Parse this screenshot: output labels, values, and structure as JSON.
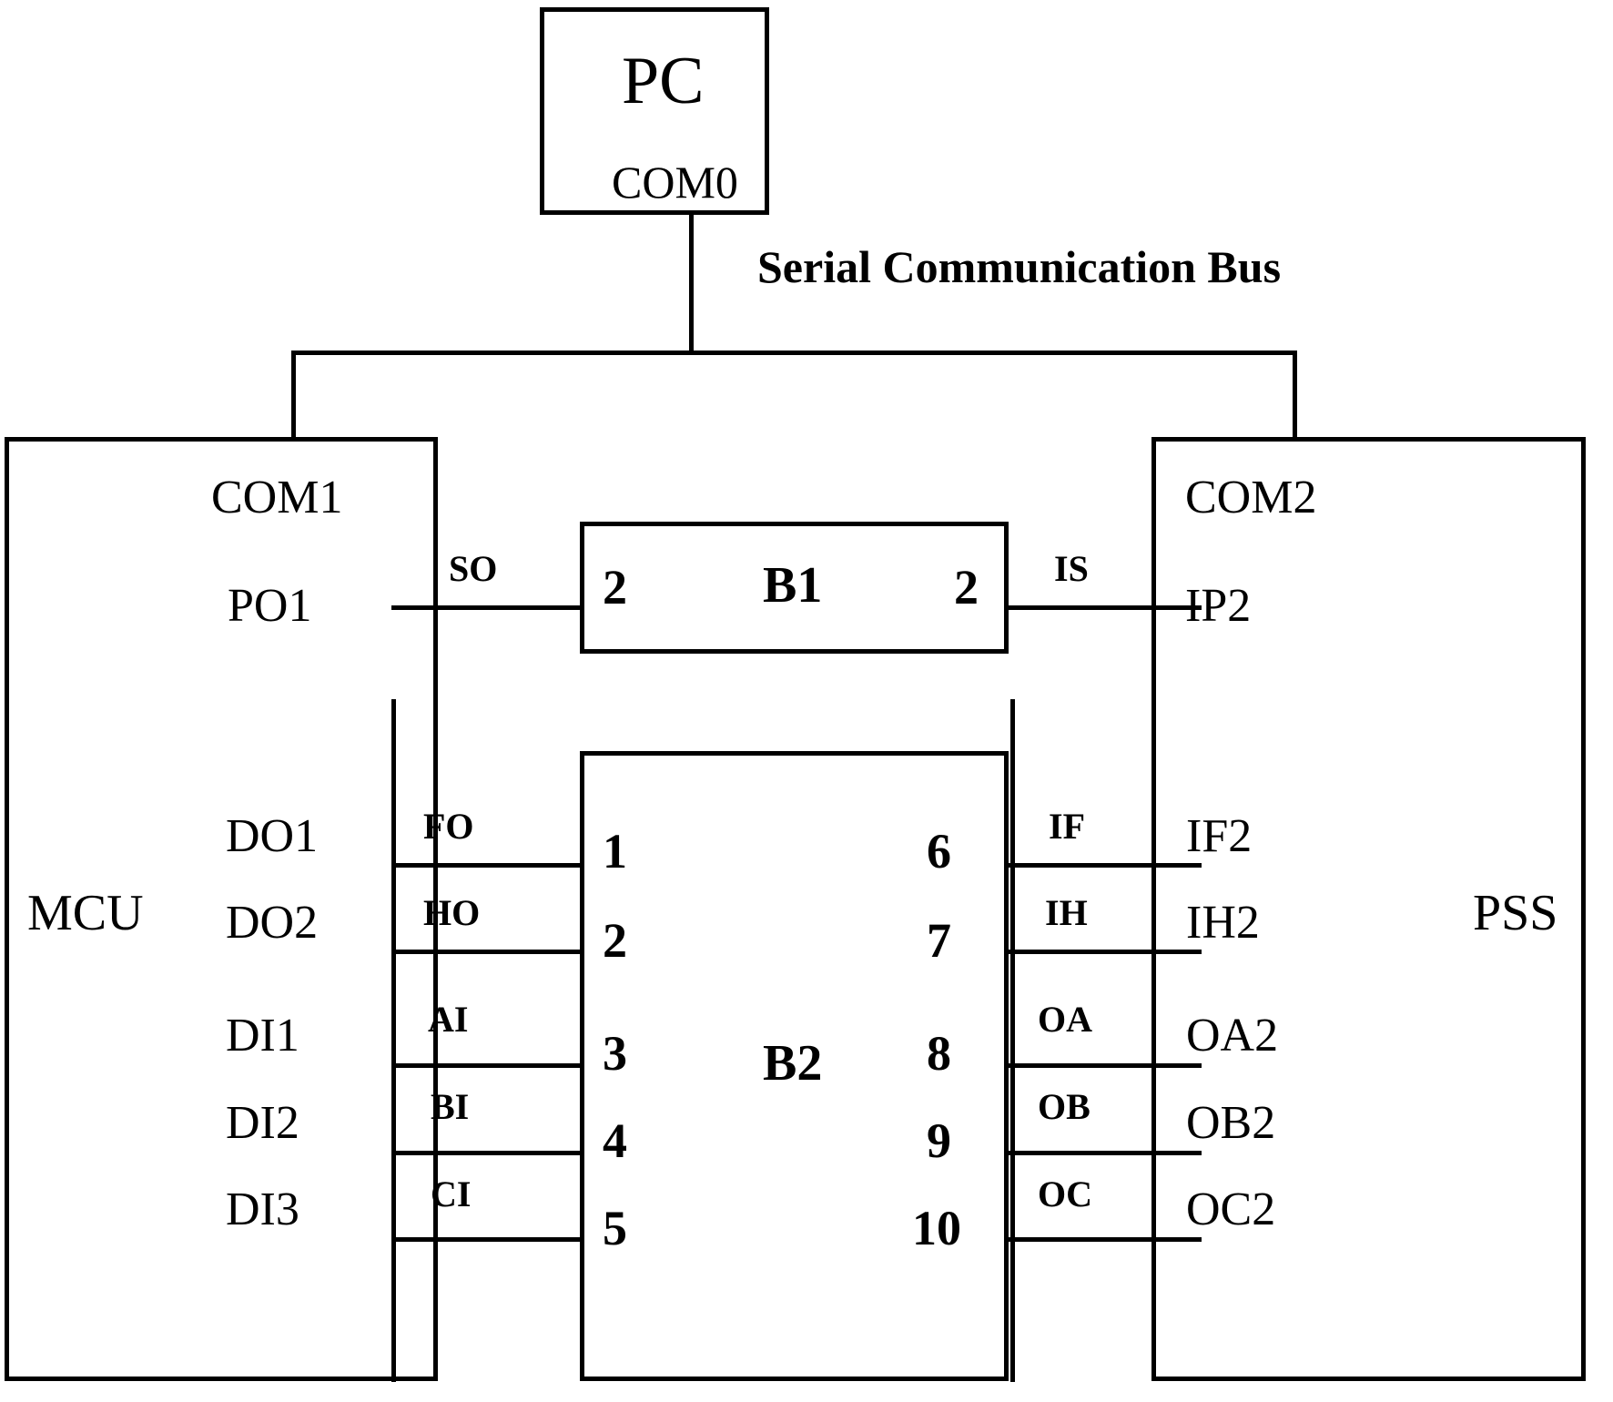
{
  "diagram": {
    "title_visible": false,
    "bus_label": "Serial Communication Bus"
  },
  "nodes": {
    "pc": {
      "name": "PC",
      "port": "COM0"
    },
    "mcu": {
      "name": "MCU",
      "com_port": "COM1"
    },
    "pss": {
      "name": "PSS",
      "com_port": "COM2"
    },
    "b1": {
      "name": "B1",
      "left_pin": "2",
      "right_pin": "2"
    },
    "b2": {
      "name": "B2"
    }
  },
  "serial_link": {
    "mcu_port": "PO1",
    "mcu_signal": "SO",
    "b1_left": "2",
    "b1_right": "2",
    "pss_signal": "IS",
    "pss_port": "IP2"
  },
  "io_links": [
    {
      "mcu_port": "DO1",
      "mcu_signal": "FO",
      "b2_left_pin": "1",
      "b2_right_pin": "6",
      "pss_signal": "IF",
      "pss_port": "IF2"
    },
    {
      "mcu_port": "DO2",
      "mcu_signal": "HO",
      "b2_left_pin": "2",
      "b2_right_pin": "7",
      "pss_signal": "IH",
      "pss_port": "IH2"
    },
    {
      "mcu_port": "DI1",
      "mcu_signal": "AI",
      "b2_left_pin": "3",
      "b2_right_pin": "8",
      "pss_signal": "OA",
      "pss_port": "OA2"
    },
    {
      "mcu_port": "DI2",
      "mcu_signal": "BI",
      "b2_left_pin": "4",
      "b2_right_pin": "9",
      "pss_signal": "OB",
      "pss_port": "OB2"
    },
    {
      "mcu_port": "DI3",
      "mcu_signal": "CI",
      "b2_left_pin": "5",
      "b2_right_pin": "10",
      "pss_signal": "OC",
      "pss_port": "OC2"
    }
  ],
  "colors": {
    "stroke": "#000000",
    "background": "#ffffff"
  }
}
